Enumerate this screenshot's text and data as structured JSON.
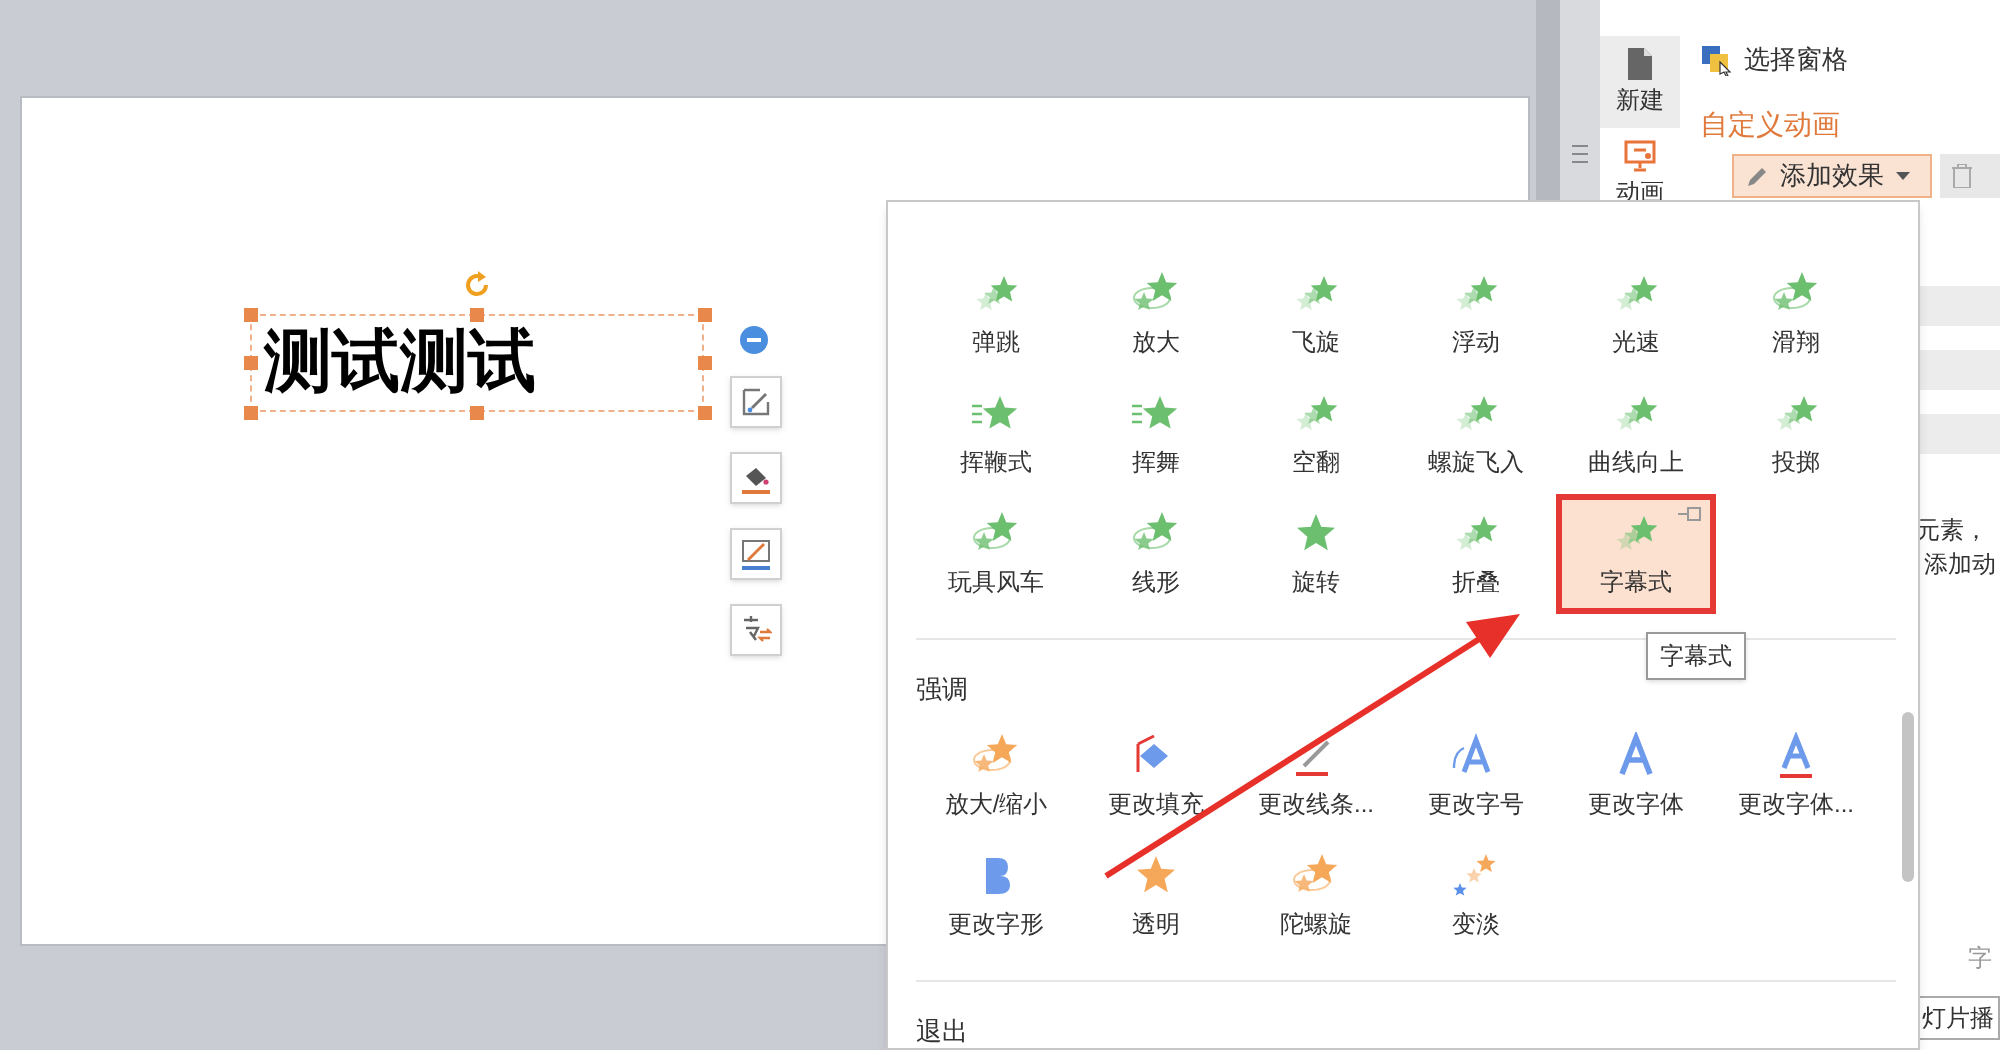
{
  "slide": {
    "text": "测试测试"
  },
  "side_tabs": [
    {
      "label": "新建",
      "kind": "new",
      "selected": false,
      "hovered": true
    },
    {
      "label": "动画",
      "kind": "animation",
      "selected": true,
      "hovered": false
    }
  ],
  "panel": {
    "select_pane": "选择窗格",
    "title": "自定义动画",
    "add_button": "添加效果",
    "hint_lines": [
      "元素，",
      "添加动"
    ],
    "font_label": "字",
    "play_button": "灯片播"
  },
  "effects_menu": {
    "sections": [
      {
        "color": "#6cbf6f",
        "items": [
          {
            "label": "弹跳",
            "kind": "trail",
            "selected": false
          },
          {
            "label": "放大",
            "kind": "orbit",
            "selected": false
          },
          {
            "label": "飞旋",
            "kind": "trail",
            "selected": false
          },
          {
            "label": "浮动",
            "kind": "trail",
            "selected": false
          },
          {
            "label": "光速",
            "kind": "trail",
            "selected": false
          },
          {
            "label": "滑翔",
            "kind": "orbit",
            "selected": false
          },
          {
            "label": "挥鞭式",
            "kind": "lines",
            "selected": false
          },
          {
            "label": "挥舞",
            "kind": "lines",
            "selected": false
          },
          {
            "label": "空翻",
            "kind": "trail",
            "selected": false
          },
          {
            "label": "螺旋飞入",
            "kind": "trail",
            "selected": false
          },
          {
            "label": "曲线向上",
            "kind": "trail",
            "selected": false
          },
          {
            "label": "投掷",
            "kind": "trail",
            "selected": false
          },
          {
            "label": "玩具风车",
            "kind": "orbit",
            "selected": false
          },
          {
            "label": "线形",
            "kind": "orbit",
            "selected": false
          },
          {
            "label": "旋转",
            "kind": "star",
            "selected": false
          },
          {
            "label": "折叠",
            "kind": "trail",
            "selected": false
          },
          {
            "label": "字幕式",
            "kind": "trail",
            "selected": true
          }
        ]
      },
      {
        "title": "强调",
        "color": "#f5a85a",
        "items": [
          {
            "label": "放大/缩小",
            "kind": "orbit",
            "selected": false
          },
          {
            "label": "更改填充",
            "kind": "fill",
            "selected": false
          },
          {
            "label": "更改线条...",
            "kind": "line",
            "selected": false
          },
          {
            "label": "更改字号",
            "kind": "font-size",
            "selected": false
          },
          {
            "label": "更改字体",
            "kind": "font",
            "selected": false
          },
          {
            "label": "更改字体...",
            "kind": "font-underline",
            "selected": false
          },
          {
            "label": "更改字形",
            "kind": "bold",
            "selected": false
          },
          {
            "label": "透明",
            "kind": "star",
            "selected": false
          },
          {
            "label": "陀螺旋",
            "kind": "orbit",
            "selected": false
          },
          {
            "label": "变淡",
            "kind": "stars",
            "selected": false
          }
        ]
      },
      {
        "title": "退出"
      }
    ],
    "tooltip": "字幕式"
  }
}
